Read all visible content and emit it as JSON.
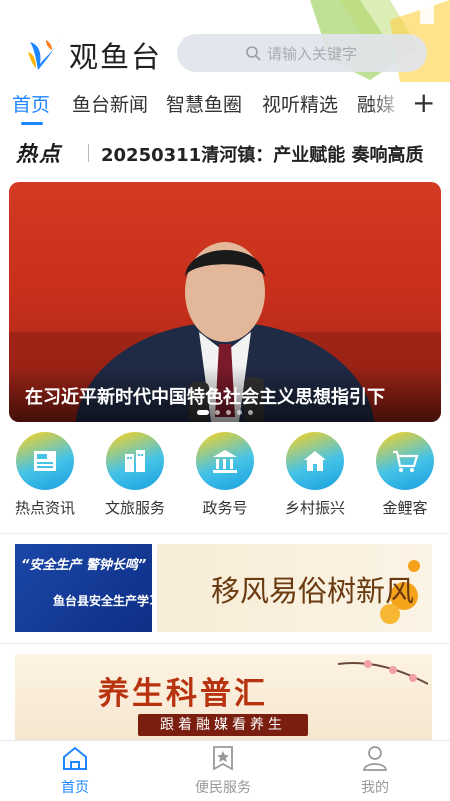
{
  "header": {
    "app_title": "观鱼台",
    "search_placeholder": "请输入关键字"
  },
  "tabs": [
    {
      "label": "首页",
      "active": true
    },
    {
      "label": "鱼台新闻"
    },
    {
      "label": "智慧鱼圈"
    },
    {
      "label": "视听精选"
    },
    {
      "label": "融媒"
    }
  ],
  "hot": {
    "label": "热点",
    "headline": "20250311清河镇：产业赋能 奏响高质"
  },
  "banner": {
    "caption": "在习近平新时代中国特色社会主义思想指引下",
    "page_count": 5,
    "active_page": 1
  },
  "quick_links": [
    {
      "label": "热点资讯",
      "icon": "newspaper-icon"
    },
    {
      "label": "文旅服务",
      "icon": "buildings-icon"
    },
    {
      "label": "政务号",
      "icon": "government-building-icon"
    },
    {
      "label": "乡村振兴",
      "icon": "village-house-icon"
    },
    {
      "label": "金鲤客",
      "icon": "shopping-cart-icon"
    }
  ],
  "promos": {
    "safety_line1": "“安全生产 警钟长鸣”",
    "safety_line2": "鱼台县安全生产学习专栏",
    "customs": "移风易俗树新风",
    "health_title": "养生科普汇",
    "health_sub": "跟着融媒看养生"
  },
  "bottom_nav": [
    {
      "label": "首页",
      "icon": "home-icon",
      "active": true
    },
    {
      "label": "便民服务",
      "icon": "service-icon"
    },
    {
      "label": "我的",
      "icon": "user-icon"
    }
  ],
  "colors": {
    "accent": "#1e86ff",
    "banner_red": "#c8301c"
  }
}
